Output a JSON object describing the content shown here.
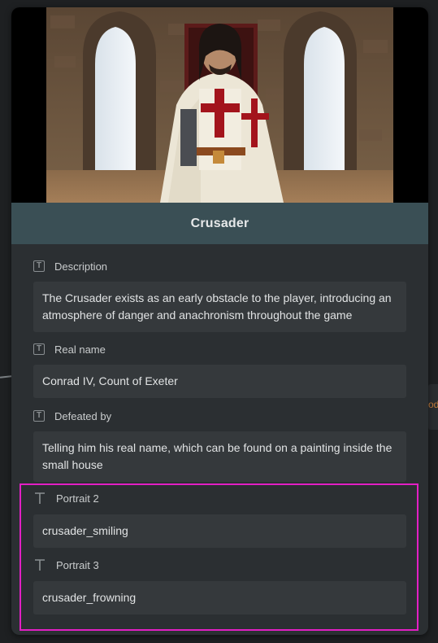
{
  "card": {
    "title": "Crusader",
    "fields": [
      {
        "label": "Description",
        "value": "The Crusader exists as an early obstacle to the player, introducing an atmosphere of danger and anachronism throughout the game"
      },
      {
        "label": "Real name",
        "value": "Conrad IV, Count of Exeter"
      },
      {
        "label": "Defeated by",
        "value": "Telling him his real name, which can be found on a painting inside the small house"
      },
      {
        "label": "Portrait 2",
        "value": "crusader_smiling"
      },
      {
        "label": "Portrait 3",
        "value": "crusader_frowning"
      }
    ]
  },
  "background": {
    "partial_text": "od"
  },
  "colors": {
    "title_bar": "#3a4f55",
    "selection": "#e21fc4",
    "cross": "#a3141c"
  },
  "icons": [
    "text-field-icon"
  ]
}
